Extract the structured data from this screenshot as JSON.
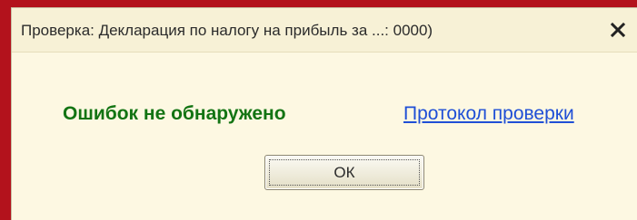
{
  "window": {
    "title": "Проверка: Декларация по налогу на прибыль за ...: 0000)",
    "close_icon": "close-icon"
  },
  "message": {
    "status_text": "Ошибок не обнаружено",
    "link_text": "Протокол проверки"
  },
  "buttons": {
    "ok_label": "ОК"
  },
  "colors": {
    "frame": "#b3121c",
    "dialog_background": "#fdf8e2",
    "status_text": "#137413",
    "link": "#1f4fd6"
  }
}
